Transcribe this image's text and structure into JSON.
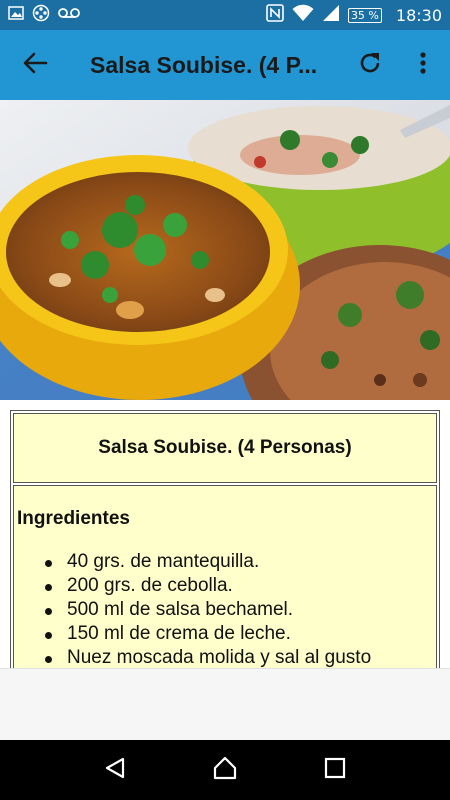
{
  "status_bar": {
    "time": "18:30",
    "battery": "35 %",
    "icons": [
      "image-icon",
      "film-reel-icon",
      "voicemail-icon",
      "nfc-icon",
      "wifi-icon",
      "signal-icon",
      "battery-icon"
    ]
  },
  "app_bar": {
    "title": "Salsa Soubise. (4 P...",
    "icons": [
      "back-arrow-icon",
      "refresh-icon",
      "more-vert-icon"
    ],
    "color": "#2196d3"
  },
  "hero_image": {
    "subject": "bowls of soup garnished with cilantro and fried patties"
  },
  "recipe": {
    "title": "Salsa Soubise. (4 Personas)",
    "ingredients_heading": "Ingredientes",
    "ingredients": [
      "40 grs. de mantequilla.",
      "200 grs. de cebolla.",
      "500 ml de salsa bechamel.",
      "150 ml de crema de leche.",
      "Nuez moscada molida y sal al gusto"
    ],
    "cell_color": "#ffffcc"
  },
  "nav_bar": {
    "icons": [
      "back-triangle-icon",
      "home-icon",
      "recents-icon"
    ]
  }
}
